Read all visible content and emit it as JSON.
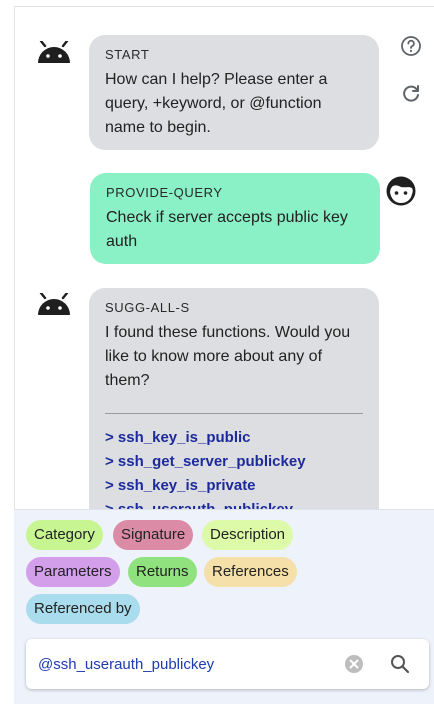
{
  "side_buttons": {
    "help_icon": "help-circle-icon",
    "refresh_icon": "refresh-icon"
  },
  "messages": [
    {
      "sender": "bot",
      "tag": "START",
      "text": "How can I help? Please enter a query, +keyword, or @function name to begin."
    },
    {
      "sender": "user",
      "tag": "PROVIDE-QUERY",
      "text": "Check if server accepts public key auth"
    },
    {
      "sender": "bot",
      "tag": "SUGG-ALL-S",
      "text": "I found these functions. Would you like to know more about any of them?",
      "links": [
        "> ssh_key_is_public",
        "> ssh_get_server_publickey",
        "> ssh_key_is_private",
        "> ssh_userauth_publickey"
      ]
    }
  ],
  "chips": [
    {
      "label": "Category",
      "color": "#c7f591"
    },
    {
      "label": "Signature",
      "color": "#dc8ba6"
    },
    {
      "label": "Description",
      "color": "#ddfaa8"
    },
    {
      "label": "Parameters",
      "color": "#d39fea"
    },
    {
      "label": "Returns",
      "color": "#8fe27d"
    },
    {
      "label": "References",
      "color": "#f4e0a8"
    },
    {
      "label": "Referenced by",
      "color": "#a9dcec"
    }
  ],
  "search": {
    "value": "@ssh_userauth_publickey",
    "clear_icon": "clear-icon",
    "search_icon": "search-icon"
  },
  "colors": {
    "bot_bubble": "#dddee1",
    "user_bubble": "#8af0c5",
    "link": "#1d2a9c",
    "input_text": "#1d3bb0"
  }
}
